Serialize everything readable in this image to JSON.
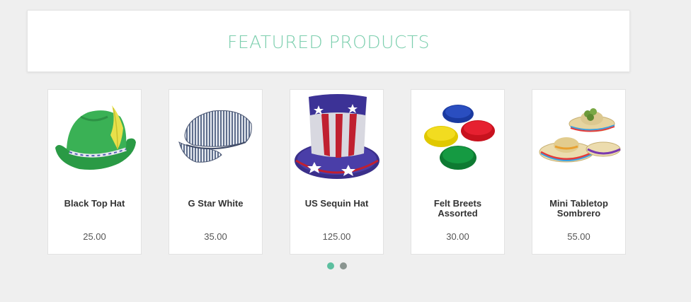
{
  "section": {
    "title": "FEATURED PRODUCTS"
  },
  "products": [
    {
      "name": "Black Top Hat",
      "price": "25.00",
      "icon": "green-feather-hat-icon"
    },
    {
      "name": "G Star White",
      "price": "35.00",
      "icon": "striped-engineer-cap-icon"
    },
    {
      "name": "US Sequin Hat",
      "price": "125.00",
      "icon": "sequin-uncle-sam-hat-icon"
    },
    {
      "name": "Felt Breets Assorted",
      "price": "30.00",
      "icon": "felt-berets-icon"
    },
    {
      "name": "Mini Tabletop Sombrero",
      "price": "55.00",
      "icon": "mini-sombreros-icon"
    }
  ],
  "carousel": {
    "pages": 2,
    "active_page": 1
  },
  "colors": {
    "accent": "#7ccfae",
    "dot_active": "#5cbf9f",
    "dot_inactive": "#8a9590",
    "background": "#efefef"
  }
}
